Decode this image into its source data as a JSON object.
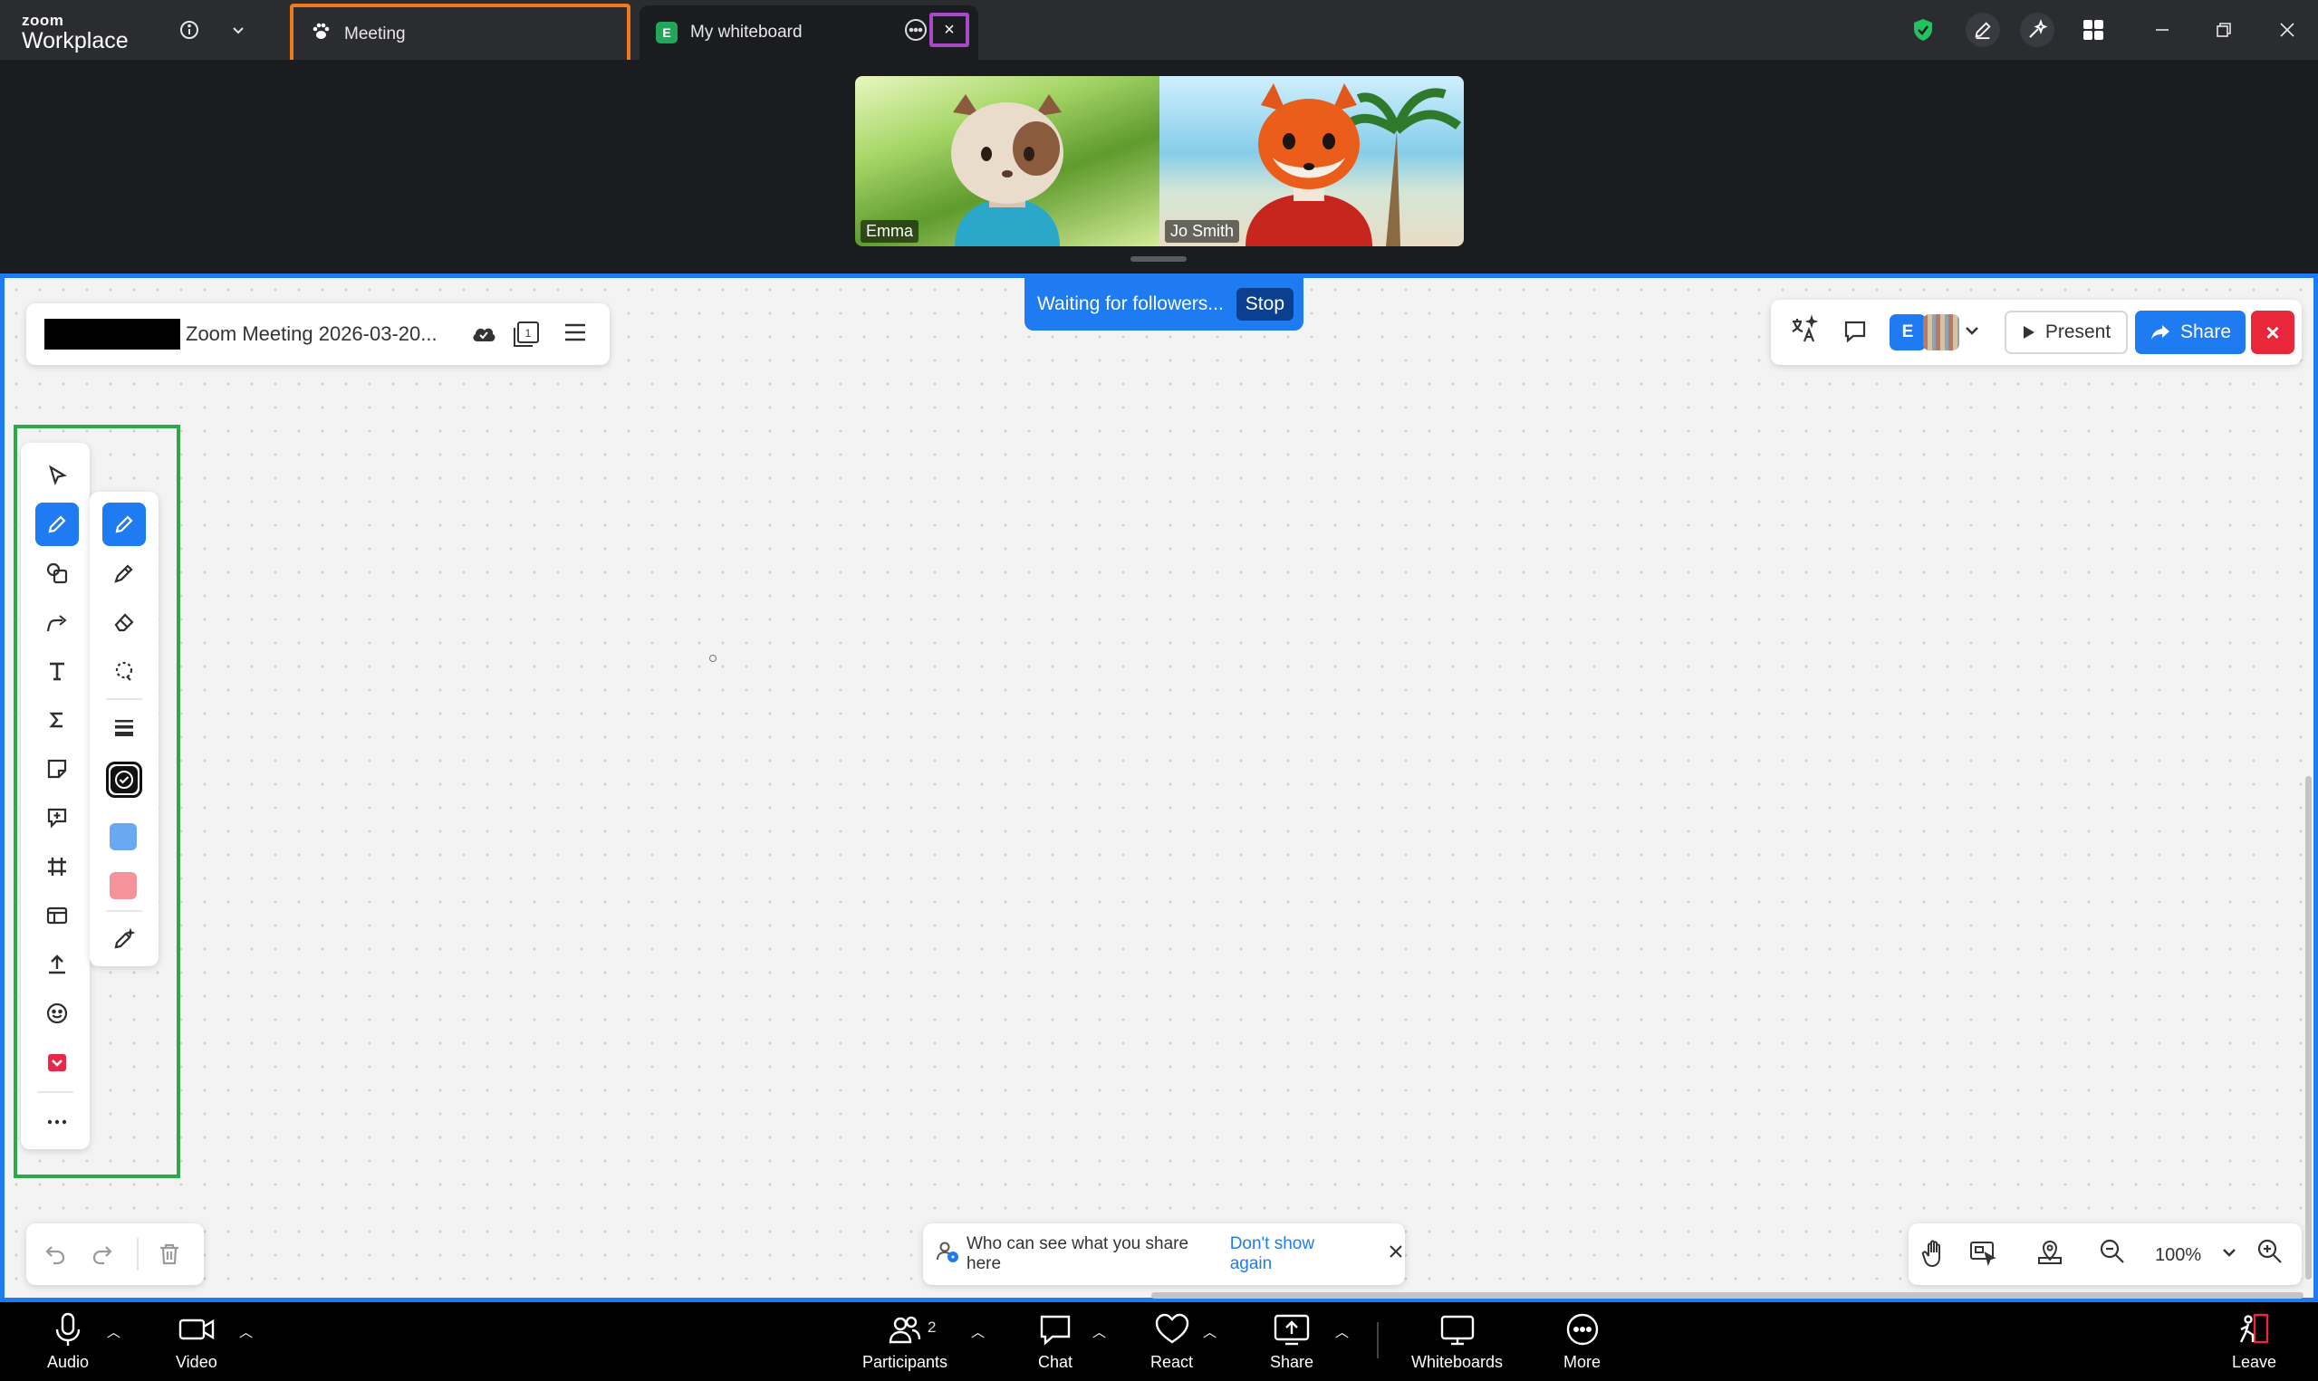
{
  "app": {
    "logo_line1": "zoom",
    "logo_line2": "Workplace"
  },
  "tabs": [
    {
      "label": "Meeting"
    },
    {
      "label": "My whiteboard",
      "badge": "E"
    }
  ],
  "title_bar": {
    "close_tab": "×",
    "icons": [
      "info-icon",
      "chevron-down-icon",
      "shield-check-icon",
      "pen-icon",
      "ai-sparkle-icon",
      "apps-icon",
      "minimize-icon",
      "restore-icon",
      "close-icon"
    ],
    "shield_color": "#22c35e"
  },
  "videos": [
    {
      "name": "Emma"
    },
    {
      "name": "Jo Smith"
    }
  ],
  "whiteboard": {
    "title": "Zoom Meeting 2026-03-20...",
    "page_count": "1",
    "follow_banner": {
      "text": "Waiting for followers...",
      "stop_label": "Stop"
    },
    "right_panel": {
      "avatar_initial": "E",
      "present_label": "Present",
      "share_label": "Share",
      "close_label": "×"
    },
    "accent_color": "#1f7bf2",
    "main_tools": [
      "select-tool",
      "pen-tool",
      "shapes-tool",
      "connector-tool",
      "text-tool",
      "formula-tool",
      "sticky-note-tool",
      "comment-tool",
      "frame-tool",
      "template-tool",
      "upload-tool",
      "emoji-tool",
      "app-tool",
      "more-tools"
    ],
    "sub_tools": [
      "pen",
      "highlighter",
      "eraser",
      "lasso",
      "stroke-width",
      "color-black",
      "color-blue",
      "color-red",
      "magic-pen"
    ],
    "swatch_colors": [
      "#111111",
      "#6aa9f2",
      "#f4949a"
    ],
    "notice": {
      "text": "Who can see what you share here",
      "link": "Don't show again"
    },
    "zoom": "100%"
  },
  "controls": {
    "audio": "Audio",
    "video": "Video",
    "participants": "Participants",
    "participants_count": "2",
    "chat": "Chat",
    "react": "React",
    "share": "Share",
    "whiteboards": "Whiteboards",
    "more": "More",
    "leave": "Leave"
  }
}
